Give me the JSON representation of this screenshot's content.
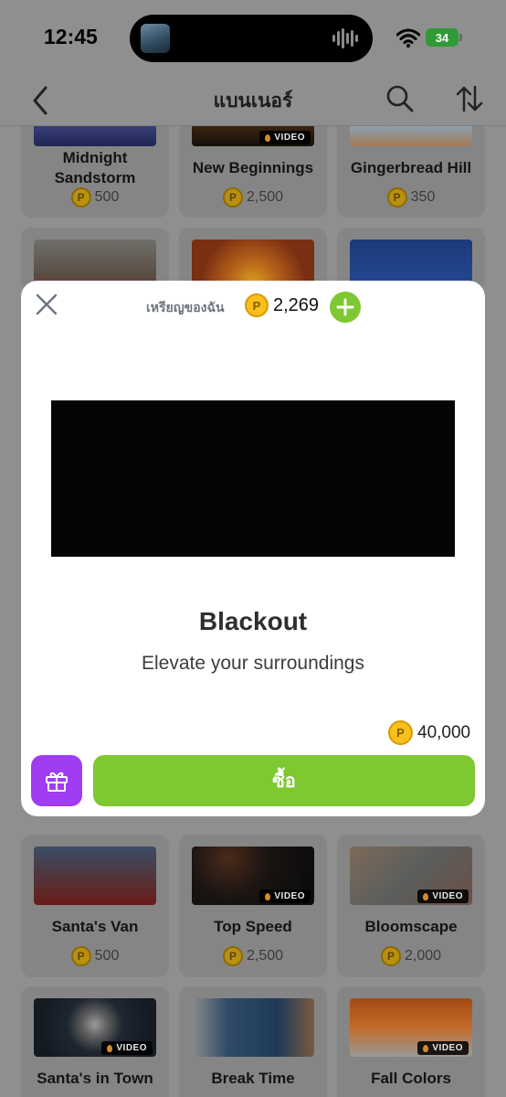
{
  "status_bar": {
    "time": "12:45",
    "battery": "34"
  },
  "nav": {
    "title": "แบนเนอร์"
  },
  "cards": [
    {
      "name": "Midnight Sandstorm",
      "price": "500",
      "video": false
    },
    {
      "name": "New Beginnings",
      "price": "2,500",
      "video": true
    },
    {
      "name": "Gingerbread Hill",
      "price": "350",
      "video": false
    },
    {
      "name": "Santa's Van",
      "price": "500",
      "video": false
    },
    {
      "name": "Top Speed",
      "price": "2,500",
      "video": true
    },
    {
      "name": "Bloomscape",
      "price": "2,000",
      "video": true
    },
    {
      "name": "Santa's in Town",
      "price": "",
      "video": true
    },
    {
      "name": "Break Time",
      "price": "",
      "video": false
    },
    {
      "name": "Fall Colors",
      "price": "",
      "video": true
    }
  ],
  "video_label": "VIDEO",
  "coin_symbol": "P",
  "modal": {
    "balance_label": "เหรียญของฉัน",
    "balance": "2,269",
    "title": "Blackout",
    "subtitle": "Elevate your surroundings",
    "cost": "40,000",
    "buy_label": "ซื้อ"
  },
  "colors": {
    "accent_green": "#7ec832",
    "gift_purple": "#a03cf2",
    "coin_gold": "#f7c01c"
  }
}
